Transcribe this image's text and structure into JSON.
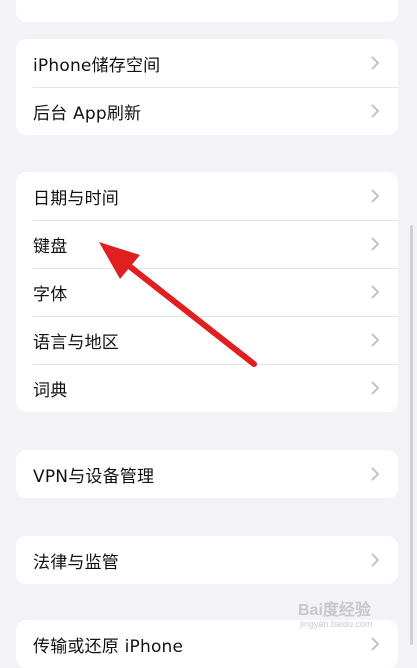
{
  "groups": [
    {
      "items": [
        {
          "label": "iPhone储存空间",
          "icon": "chevron-right-icon"
        },
        {
          "label": "后台 App刷新",
          "icon": "chevron-right-icon"
        }
      ]
    },
    {
      "items": [
        {
          "label": "日期与时间",
          "icon": "chevron-right-icon"
        },
        {
          "label": "键盘",
          "icon": "chevron-right-icon"
        },
        {
          "label": "字体",
          "icon": "chevron-right-icon"
        },
        {
          "label": "语言与地区",
          "icon": "chevron-right-icon"
        },
        {
          "label": "词典",
          "icon": "chevron-right-icon"
        }
      ]
    },
    {
      "items": [
        {
          "label": "VPN与设备管理",
          "icon": "chevron-right-icon"
        }
      ]
    },
    {
      "items": [
        {
          "label": "法律与监管",
          "icon": "chevron-right-icon"
        }
      ]
    },
    {
      "items": [
        {
          "label": "传输或还原 iPhone",
          "icon": "chevron-right-icon"
        }
      ]
    }
  ],
  "annotation": {
    "color": "#e02020",
    "icon": "red-arrow-annotation",
    "points_to": "键盘"
  },
  "watermark": {
    "text": "Bai度经验",
    "subtext": "jingyan.baidu.com"
  },
  "colors": {
    "background": "#f2f2f7",
    "card": "#ffffff",
    "chevron": "#c4c4c7",
    "separator": "#e3e3e8"
  }
}
